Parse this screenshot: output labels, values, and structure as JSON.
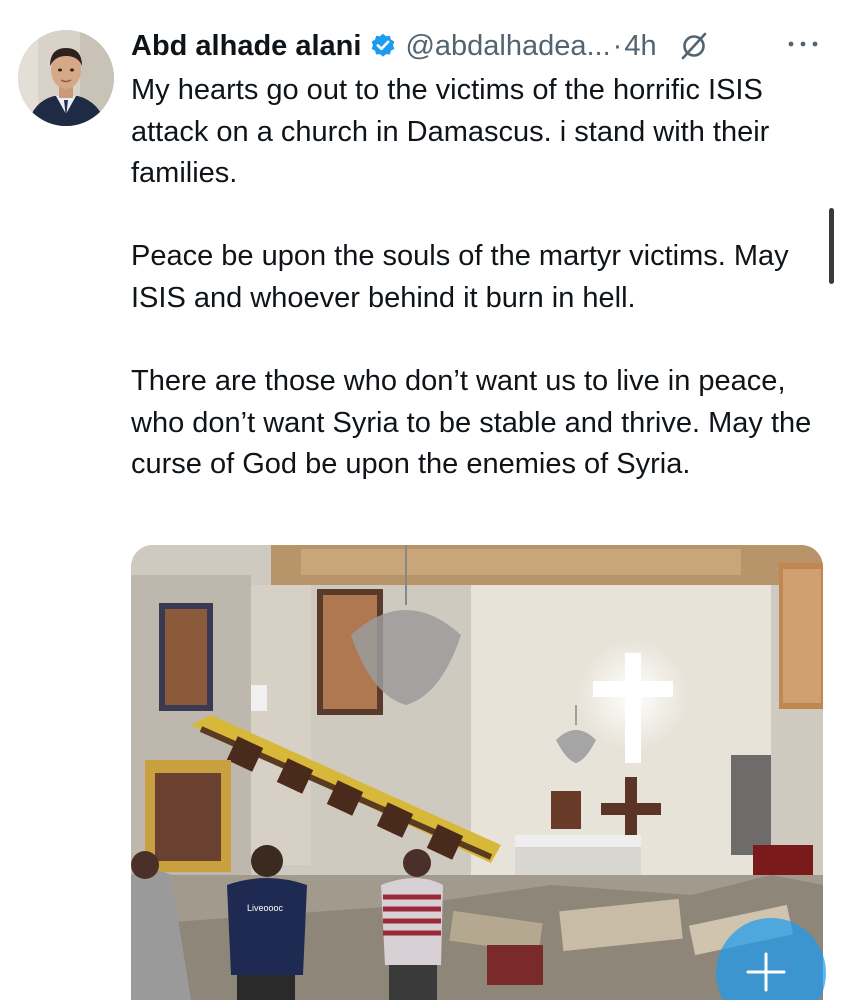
{
  "author": {
    "name": "Abd alhade alani",
    "handle": "@abdalhadea...",
    "separator": "·",
    "time": "4h"
  },
  "icons": {
    "verified": "verified-badge-icon",
    "grok": "grok-icon",
    "more": "more-options-icon",
    "compose": "compose-plus-icon"
  },
  "colors": {
    "verified_blue": "#1d9bf0",
    "text_primary": "#0f1419",
    "text_secondary": "#536471"
  },
  "tweet": {
    "paragraphs": [
      "My hearts go out to the victims of the horrific ISIS attack on a church in Damascus. i stand with their families.",
      "Peace be upon the souls of the martyr victims. May ISIS and whoever behind it burn in hell.",
      "There are those who don’t want us to live in peace, who don’t want Syria to be stable and thrive. May the curse of God be upon the enemies of Syria."
    ]
  },
  "media": {
    "shirt_text": "Liveoooc"
  }
}
